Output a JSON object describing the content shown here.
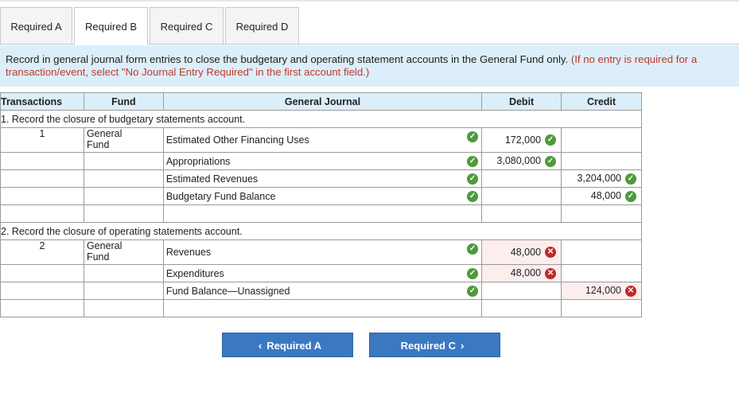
{
  "tabs": [
    "Required A",
    "Required B",
    "Required C",
    "Required D"
  ],
  "active_tab": "Required B",
  "instructions": {
    "main": "Record in general journal form entries to close the budgetary and operating statement accounts in the General Fund only.",
    "note": "(If no entry is required for a transaction/event, select \"No Journal Entry Required\" in the first account field.)"
  },
  "table": {
    "headers": {
      "transactions": "Transactions",
      "fund": "Fund",
      "general_journal": "General Journal",
      "debit": "Debit",
      "credit": "Credit"
    },
    "sections": [
      {
        "title": "1. Record the closure of budgetary statements account.",
        "number": "1",
        "fund": "General Fund",
        "rows": [
          {
            "account": "Estimated Other Financing Uses",
            "debit": "172,000",
            "debit_status": "correct",
            "credit": ""
          },
          {
            "account": "Appropriations",
            "debit": "3,080,000",
            "debit_status": "correct",
            "credit": ""
          },
          {
            "account": "Estimated Revenues",
            "debit": "",
            "credit": "3,204,000",
            "credit_status": "correct"
          },
          {
            "account": "Budgetary Fund Balance",
            "debit": "",
            "credit": "48,000",
            "credit_status": "correct"
          }
        ]
      },
      {
        "title": "2. Record the closure of operating statements account.",
        "number": "2",
        "fund": "General Fund",
        "rows": [
          {
            "account": "Revenues",
            "debit": "48,000",
            "debit_status": "incorrect",
            "credit": ""
          },
          {
            "account": "Expenditures",
            "debit": "48,000",
            "debit_status": "incorrect",
            "credit": ""
          },
          {
            "account": "Fund Balance—Unassigned",
            "debit": "",
            "credit": "124,000",
            "credit_status": "incorrect"
          }
        ]
      }
    ]
  },
  "nav": {
    "prev_label": "Required A",
    "next_label": "Required C"
  },
  "colors": {
    "accent": "#3a78c2",
    "header_bg": "#dceefa",
    "correct": "#4e9a3c",
    "incorrect": "#c0292b",
    "note_red": "#c0392b"
  }
}
